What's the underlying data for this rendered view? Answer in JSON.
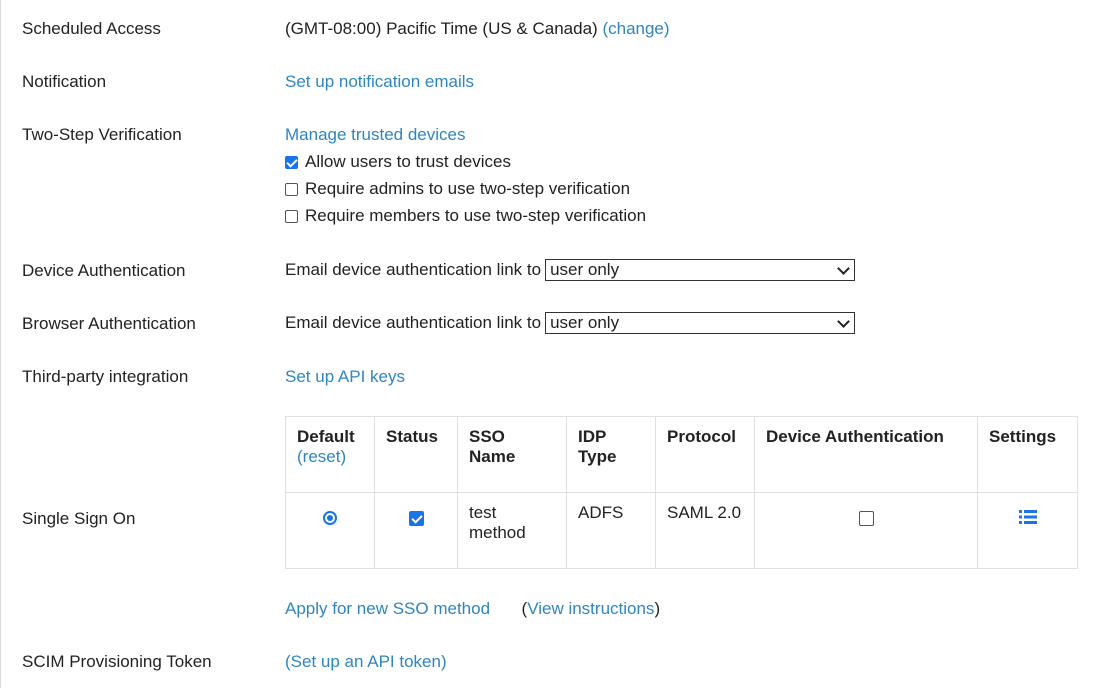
{
  "rows": {
    "scheduled_access": {
      "label": "Scheduled Access",
      "timezone": "(GMT-08:00) Pacific Time (US & Canada)",
      "change_link": "(change)"
    },
    "notification": {
      "label": "Notification",
      "link": "Set up notification emails"
    },
    "two_step": {
      "label": "Two-Step Verification",
      "link": "Manage trusted devices",
      "options": [
        {
          "label": "Allow users to trust devices",
          "checked": true
        },
        {
          "label": "Require admins to use two-step verification",
          "checked": false
        },
        {
          "label": "Require members to use two-step verification",
          "checked": false
        }
      ]
    },
    "device_auth": {
      "label": "Device Authentication",
      "prefix": "Email device authentication link to",
      "selected": "user only"
    },
    "browser_auth": {
      "label": "Browser Authentication",
      "prefix": "Email device authentication link to",
      "selected": "user only"
    },
    "third_party": {
      "label": "Third-party integration",
      "link": "Set up API keys"
    },
    "sso": {
      "label": "Single Sign On",
      "headers": {
        "default": "Default",
        "reset": "(reset)",
        "status": "Status",
        "sso_name": "SSO Name",
        "idp_type": "IDP Type",
        "protocol": "Protocol",
        "device_auth": "Device Authentication",
        "settings": "Settings"
      },
      "row": {
        "default_selected": true,
        "status_checked": true,
        "sso_name": "test method",
        "idp_type": "ADFS",
        "protocol": "SAML 2.0",
        "device_auth_checked": false,
        "settings_icon": "list-icon"
      },
      "apply_link": "Apply for new SSO method",
      "instructions_link": "View instructions",
      "instructions_open": "(",
      "instructions_close": ")"
    },
    "scim": {
      "label": "SCIM Provisioning Token",
      "link": "(Set up an API token)"
    }
  },
  "colors": {
    "link": "#2e86c1",
    "accent": "#1a73e8",
    "text": "#222222"
  }
}
